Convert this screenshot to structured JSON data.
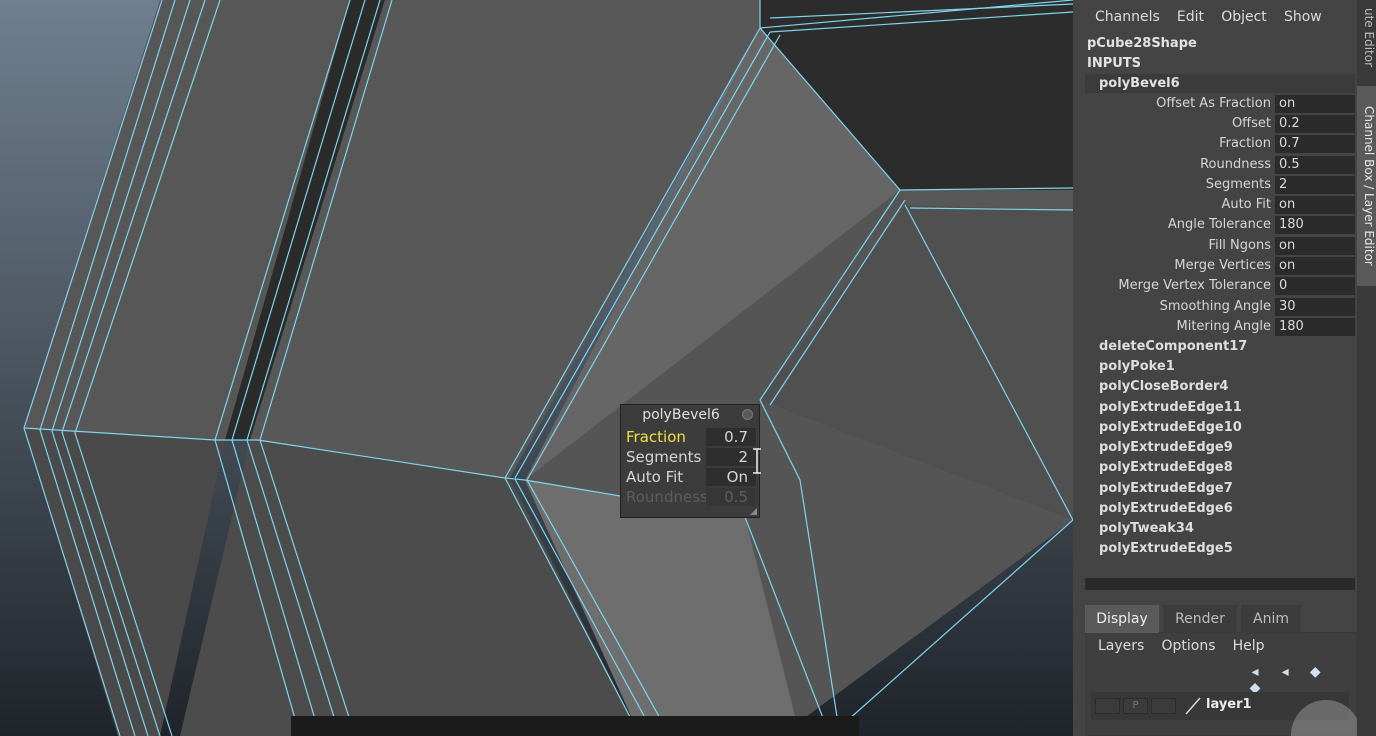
{
  "channel_box": {
    "menu": [
      "Channels",
      "Edit",
      "Object",
      "Show"
    ],
    "shape_name": "pCube28Shape",
    "inputs_label": "INPUTS",
    "node_name": "polyBevel6",
    "attributes": [
      {
        "label": "Offset As Fraction",
        "value": "on"
      },
      {
        "label": "Offset",
        "value": "0.2"
      },
      {
        "label": "Fraction",
        "value": "0.7"
      },
      {
        "label": "Roundness",
        "value": "0.5"
      },
      {
        "label": "Segments",
        "value": "2"
      },
      {
        "label": "Auto Fit",
        "value": "on"
      },
      {
        "label": "Angle Tolerance",
        "value": "180"
      },
      {
        "label": "Fill Ngons",
        "value": "on"
      },
      {
        "label": "Merge Vertices",
        "value": "on"
      },
      {
        "label": "Merge Vertex Tolerance",
        "value": "0"
      },
      {
        "label": "Smoothing Angle",
        "value": "30"
      },
      {
        "label": "Mitering Angle",
        "value": "180"
      }
    ],
    "history": [
      "deleteComponent17",
      "polyPoke1",
      "polyCloseBorder4",
      "polyExtrudeEdge11",
      "polyExtrudeEdge10",
      "polyExtrudeEdge9",
      "polyExtrudeEdge8",
      "polyExtrudeEdge7",
      "polyExtrudeEdge6",
      "polyTweak34",
      "polyExtrudeEdge5"
    ]
  },
  "side_tabs": {
    "attribute_editor": "ute Editor",
    "channel_box": "Channel Box / Layer Editor"
  },
  "layer_editor": {
    "tabs": [
      "Display",
      "Render",
      "Anim"
    ],
    "active_tab": "Display",
    "menu": [
      "Layers",
      "Options",
      "Help"
    ],
    "icons": [
      "move-layer-up-icon",
      "move-layer-down-icon",
      "new-layer-icon",
      "new-layer-from-selected-icon"
    ],
    "layer": {
      "visibility": "",
      "playback": "P",
      "name": "layer1"
    }
  },
  "inview_editor": {
    "title": "polyBevel6",
    "rows": [
      {
        "label": "Fraction",
        "value": "0.7",
        "state": "active"
      },
      {
        "label": "Segments",
        "value": "2",
        "state": "normal"
      },
      {
        "label": "Auto Fit",
        "value": "On",
        "state": "normal"
      },
      {
        "label": "Roundness",
        "value": "0.5",
        "state": "disabled"
      }
    ]
  },
  "colors": {
    "wire_highlight": "#7fd4ee",
    "active_label": "#f0e040"
  }
}
